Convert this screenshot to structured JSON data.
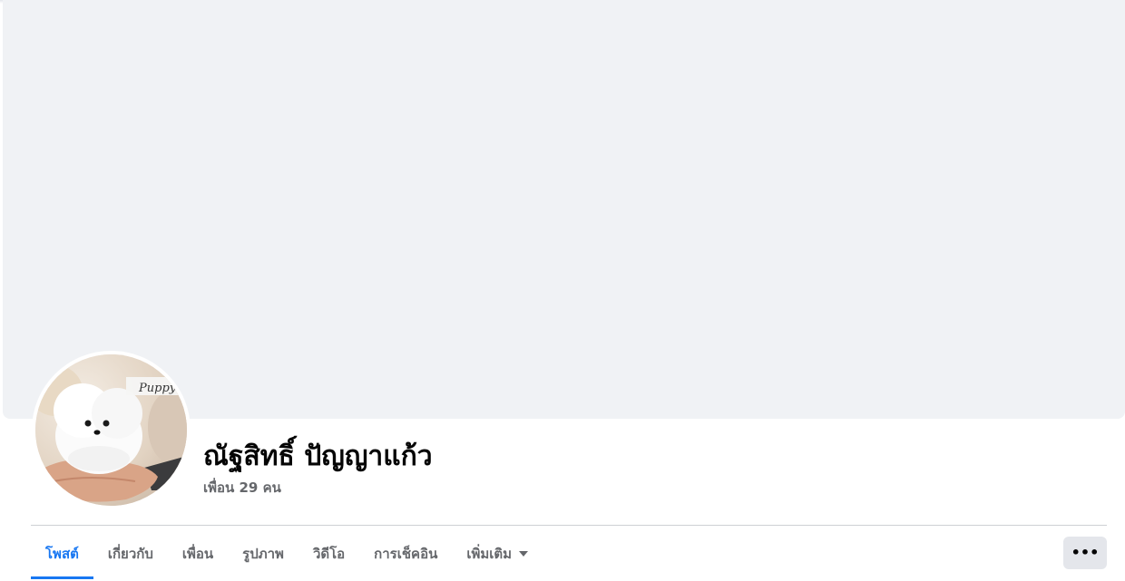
{
  "profile": {
    "name": "ณัฐสิทธิ์ ปัญญาแก้ว",
    "friends_count_text": "เพื่อน 29 คน",
    "avatar_watermark": "Puppy"
  },
  "tabs": [
    {
      "label": "โพสต์",
      "active": true
    },
    {
      "label": "เกี่ยวกับ",
      "active": false
    },
    {
      "label": "เพื่อน",
      "active": false
    },
    {
      "label": "รูปภาพ",
      "active": false
    },
    {
      "label": "วิดีโอ",
      "active": false
    },
    {
      "label": "การเช็คอิน",
      "active": false
    },
    {
      "label": "เพิ่มเติม",
      "active": false,
      "dropdown": true
    }
  ],
  "more_button": {
    "icon": "more-horizontal-icon",
    "label": "•••"
  },
  "colors": {
    "accent": "#1877f2",
    "cover_bg": "#f0f2f5",
    "secondary_text": "#65676b",
    "primary_text": "#050505"
  }
}
